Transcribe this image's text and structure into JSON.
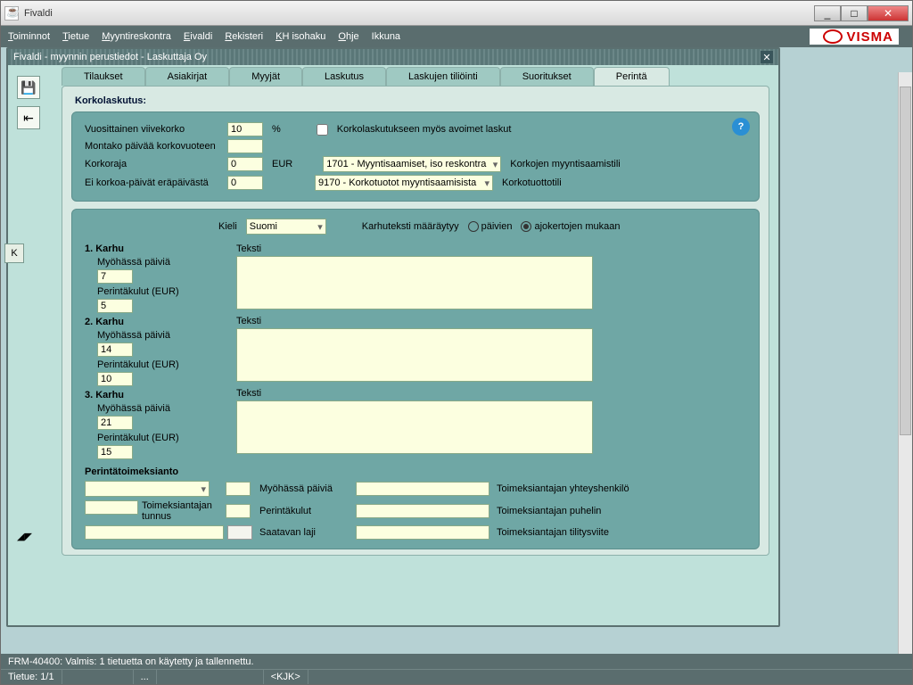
{
  "window": {
    "title": "Fivaldi"
  },
  "menu": {
    "items": [
      "Toiminnot",
      "Tietue",
      "Myyntireskontra",
      "Eivaldi",
      "Rekisteri",
      "KH isohaku",
      "Ohje",
      "Ikkuna"
    ]
  },
  "brand": "VISMA",
  "subwindow": {
    "title": "Fivaldi - myynnin perustiedot - Laskuttaja Oy"
  },
  "tabs": [
    "Tilaukset",
    "Asiakirjat",
    "Myyjät",
    "Laskutus",
    "Laskujen tiliöinti",
    "Suoritukset",
    "Perintä"
  ],
  "active_tab": 6,
  "section_heading": "Korkolaskutus:",
  "korko": {
    "vuosi_label": "Vuosittainen viivekorko",
    "vuosi_value": "10",
    "percent": "%",
    "checkbox_label": "Korkolaskutukseen myös avoimet laskut",
    "montako_label": "Montako päivää korkovuoteen",
    "montako_value": "",
    "raja_label": "Korkoraja",
    "raja_value": "0",
    "eur": "EUR",
    "eikorkoa_label": "Ei korkoa-päivät eräpäivästä",
    "eikorkoa_value": "0",
    "sel1": "1701 - Myyntisaamiset, iso reskontra",
    "sel1_side": "Korkojen myyntisaamistili",
    "sel2": "9170 - Korkotuotot myyntisaamisista",
    "sel2_side": "Korkotuottotili"
  },
  "lang": {
    "label": "Kieli",
    "value": "Suomi",
    "karhu_label": "Karhuteksti määräytyy",
    "opt_paiv": "päivien",
    "opt_ajo": "ajokertojen mukaan"
  },
  "karhut": [
    {
      "title": "1. Karhu",
      "myo_label": "Myöhässä päiviä",
      "myo": "7",
      "per_label": "Perintäkulut (EUR)",
      "per": "5",
      "teksti_label": "Teksti",
      "teksti": ""
    },
    {
      "title": "2. Karhu",
      "myo_label": "Myöhässä päiviä",
      "myo": "14",
      "per_label": "Perintäkulut (EUR)",
      "per": "10",
      "teksti_label": "Teksti",
      "teksti": ""
    },
    {
      "title": "3. Karhu",
      "myo_label": "Myöhässä päiviä",
      "myo": "21",
      "per_label": "Perintäkulut (EUR)",
      "per": "15",
      "teksti_label": "Teksti",
      "teksti": ""
    }
  ],
  "toimeksi": {
    "heading": "Perintätoimeksianto",
    "myo_label": "Myöhässä päiviä",
    "per_label": "Perintäkulut",
    "tunnus_label": "Toimeksiantajan tunnus",
    "saatavan_label": "Saatavan laji",
    "yht_label": "Toimeksiantajan yhteyshenkilö",
    "puh_label": "Toimeksiantajan puhelin",
    "til_label": "Toimeksiantajan tilitysviite"
  },
  "status": {
    "line1": "FRM-40400: Valmis: 1 tietuetta on käytetty ja tallennettu.",
    "tietue": "Tietue: 1/1",
    "dots": "...",
    "kjk": "<KJK>"
  },
  "side_k": "K"
}
